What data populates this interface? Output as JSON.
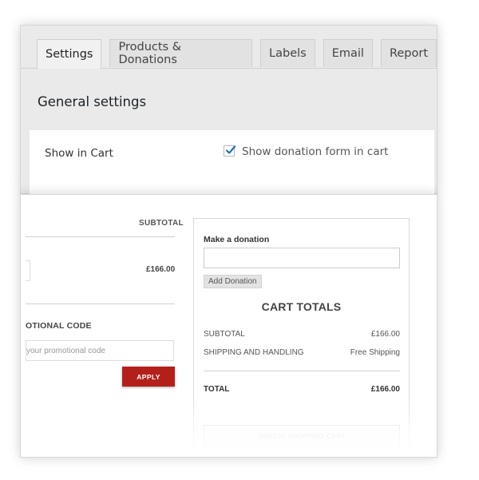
{
  "settings": {
    "tabs": [
      "Settings",
      "Products & Donations",
      "Labels",
      "Email",
      "Report"
    ],
    "active_tab": "Settings",
    "section_title": "General settings",
    "show_in_cart": {
      "label": "Show in Cart",
      "checkbox_label": "Show donation form in cart",
      "checked": true
    },
    "accent_color": "#2271b1"
  },
  "cart": {
    "subtotal_header": "SUBTOTAL",
    "row_price": "£166.00",
    "promo_heading": "OTIONAL CODE",
    "promo_placeholder": "your promotional code",
    "apply_label": "APPLY",
    "apply_color": "#b3201b",
    "donation": {
      "label": "Make a donation",
      "input_value": "",
      "button_label": "Add Donation"
    },
    "totals": {
      "title": "CART TOTALS",
      "rows": [
        {
          "label": "SUBTOTAL",
          "value": "£166.00"
        },
        {
          "label": "SHIPPING AND HANDLING",
          "value": "Free Shipping"
        }
      ],
      "total_label": "TOTAL",
      "total_value": "£166.00",
      "update_label": "UPDATE SHOPPING CART"
    }
  }
}
